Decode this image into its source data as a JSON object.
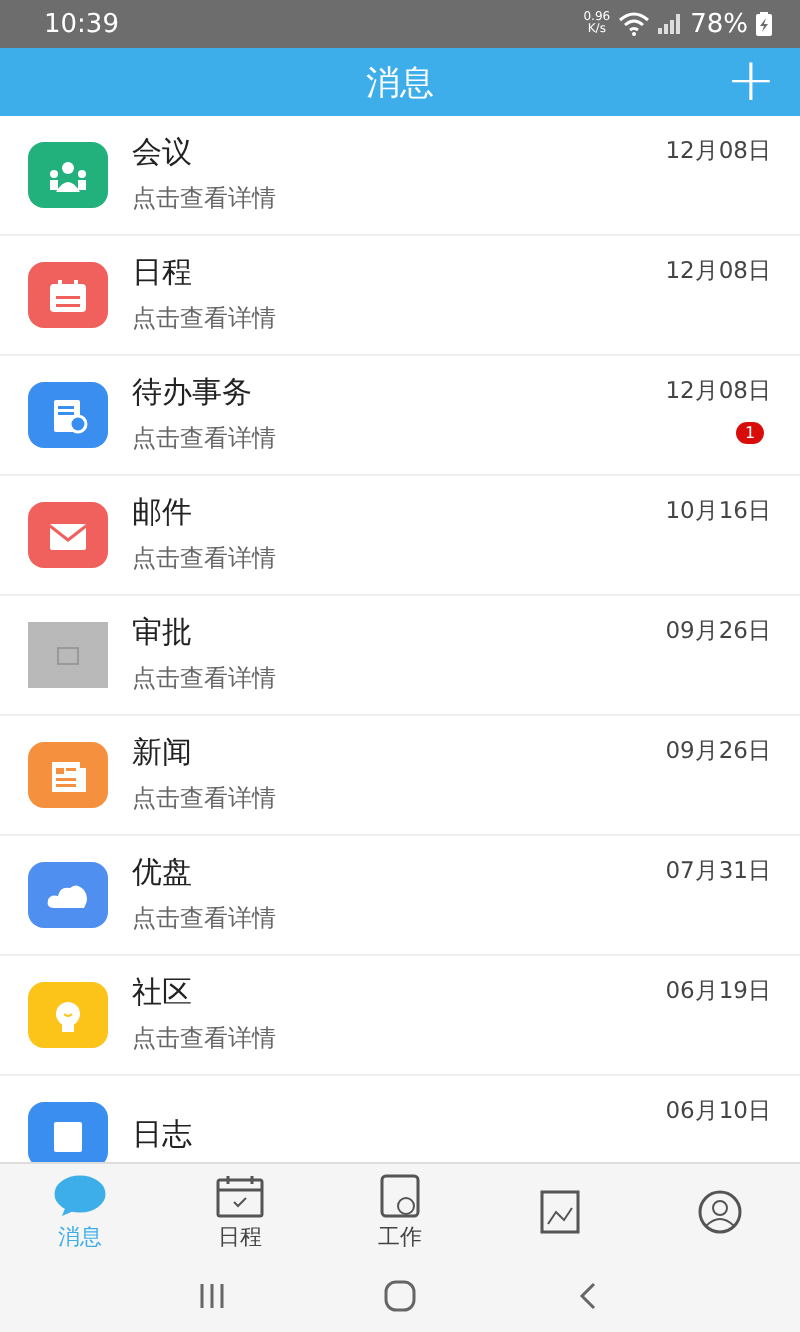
{
  "status_bar": {
    "time": "10:39",
    "net_speed_value": "0.96",
    "net_speed_unit": "K/s",
    "battery": "78%"
  },
  "header": {
    "title": "消息",
    "add_button": "+"
  },
  "messages": [
    {
      "kind": "meeting",
      "color": "#22b07d",
      "title": "会议",
      "subtitle": "点击查看详情",
      "date": "12月08日"
    },
    {
      "kind": "calendar",
      "color": "#f0605d",
      "title": "日程",
      "subtitle": "点击查看详情",
      "date": "12月08日"
    },
    {
      "kind": "todo",
      "color": "#3a8ef0",
      "title": "待办事务",
      "subtitle": "点击查看详情",
      "date": "12月08日",
      "badge": "1"
    },
    {
      "kind": "mail",
      "color": "#f0605d",
      "title": "邮件",
      "subtitle": "点击查看详情",
      "date": "10月16日"
    },
    {
      "kind": "placeholder",
      "color": "#b9b9b9",
      "title": "审批",
      "subtitle": "点击查看详情",
      "date": "09月26日"
    },
    {
      "kind": "news",
      "color": "#f5913e",
      "title": "新闻",
      "subtitle": "点击查看详情",
      "date": "09月26日"
    },
    {
      "kind": "cloud",
      "color": "#4f8ff0",
      "title": "优盘",
      "subtitle": "点击查看详情",
      "date": "07月31日"
    },
    {
      "kind": "community",
      "color": "#fcc419",
      "title": "社区",
      "subtitle": "点击查看详情",
      "date": "06月19日"
    },
    {
      "kind": "log",
      "color": "#3a8ef0",
      "title": "日志",
      "date": "06月10日"
    }
  ],
  "tabs": [
    {
      "kind": "chat",
      "label": "消息",
      "selected": true
    },
    {
      "kind": "calendar",
      "label": "日程",
      "selected": false
    },
    {
      "kind": "work",
      "label": "工作",
      "selected": false
    },
    {
      "kind": "picture",
      "selected": false
    },
    {
      "kind": "person",
      "selected": false
    }
  ]
}
